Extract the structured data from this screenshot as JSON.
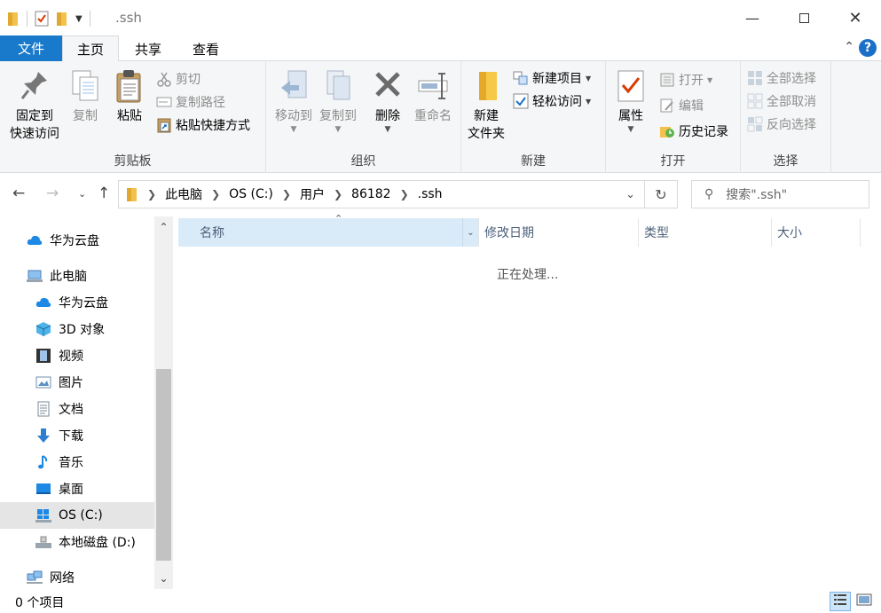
{
  "title": ".ssh",
  "colors": {
    "file_tab": "#1979ca",
    "sorted_column": "#d9ebf9",
    "selected_nav": "#e5e5e5"
  },
  "tabs": [
    "文件",
    "主页",
    "共享",
    "查看"
  ],
  "ribbon": {
    "clipboard": {
      "label": "剪贴板",
      "pin": [
        "固定到",
        "快速访问"
      ],
      "copy": "复制",
      "paste": "粘贴",
      "cut": "剪切",
      "copy_path": "复制路径",
      "paste_shortcut": "粘贴快捷方式"
    },
    "organize": {
      "label": "组织",
      "move_to": "移动到",
      "copy_to": "复制到",
      "delete": "删除",
      "rename": "重命名"
    },
    "new": {
      "label": "新建",
      "new_folder": [
        "新建",
        "文件夹"
      ],
      "new_item": "新建项目",
      "easy_access": "轻松访问"
    },
    "open": {
      "label": "打开",
      "properties": "属性",
      "open": "打开",
      "edit": "编辑",
      "history": "历史记录"
    },
    "select": {
      "label": "选择",
      "select_all": "全部选择",
      "select_none": "全部取消",
      "invert": "反向选择"
    }
  },
  "address": {
    "crumbs": [
      "此电脑",
      "OS (C:)",
      "用户",
      "86182",
      ".ssh"
    ],
    "search_placeholder": "搜索\".ssh\""
  },
  "nav": {
    "huawei_top": "华为云盘",
    "this_pc": "此电脑",
    "huawei": "华为云盘",
    "objects3d": "3D 对象",
    "videos": "视频",
    "pictures": "图片",
    "documents": "文档",
    "downloads": "下载",
    "music": "音乐",
    "desktop": "桌面",
    "os_c": "OS (C:)",
    "local_d": "本地磁盘 (D:)",
    "network": "网络"
  },
  "columns": [
    "名称",
    "修改日期",
    "类型",
    "大小"
  ],
  "working_text": "正在处理...",
  "status": {
    "count": "0 个项目"
  }
}
